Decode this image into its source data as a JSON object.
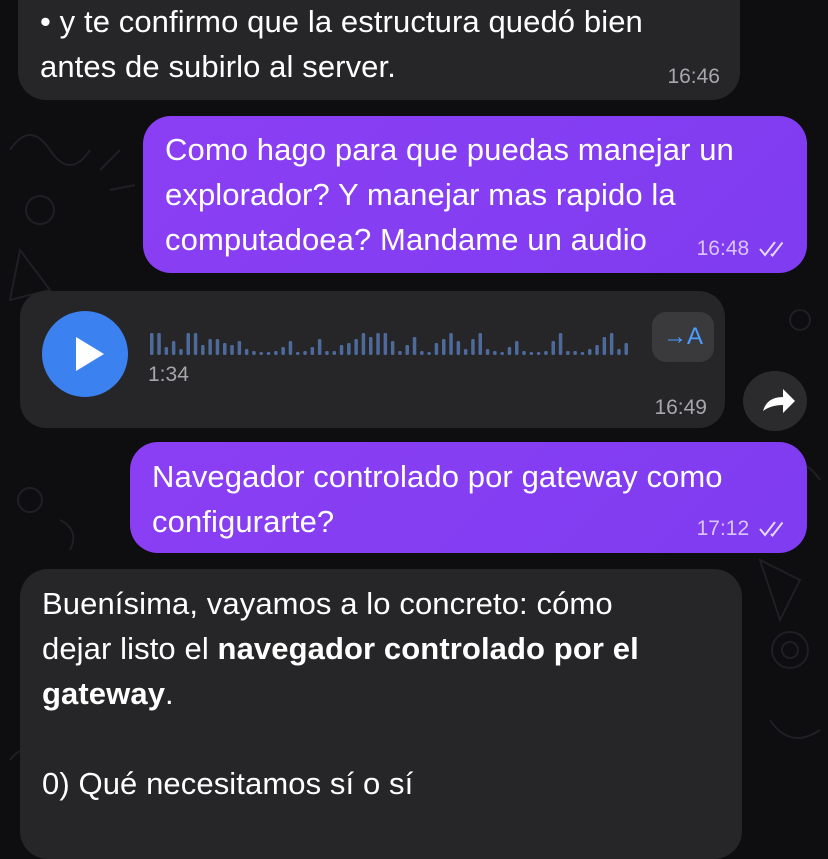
{
  "messages": [
    {
      "id": "m1",
      "direction": "incoming",
      "lines": [
        "• y te confirmo que la estructura quedó bien",
        "antes de subirlo al server."
      ],
      "time": "16:46"
    },
    {
      "id": "m2",
      "direction": "outgoing",
      "lines": [
        "Como hago para que puedas manejar un",
        "explorador? Y manejar mas rapido la",
        "computadoea? Mandame un audio"
      ],
      "time": "16:48",
      "read": true
    },
    {
      "id": "m3",
      "direction": "incoming",
      "type": "voice",
      "duration": "1:34",
      "transcribe_label": "→A",
      "time": "16:49",
      "icons": [
        "play-icon",
        "transcribe-icon",
        "forward-icon"
      ]
    },
    {
      "id": "m4",
      "direction": "outgoing",
      "lines": [
        "Navegador controlado por gateway como",
        "configurarte?"
      ],
      "time": "17:12",
      "read": true
    },
    {
      "id": "m5",
      "direction": "incoming",
      "intro": "Buenísima, vayamos a lo concreto: cómo",
      "intro2": "dejar listo el ",
      "bold": "navegador controlado por el",
      "bold2": "gateway",
      "end": ".",
      "heading": "0) Qué necesitamos sí o sí"
    }
  ],
  "colors": {
    "background": "#0e0e10",
    "incoming_bubble": "#262628",
    "outgoing_bubble": "#8b3ff4",
    "play_button": "#3b82f0",
    "link_blue": "#4c9dff"
  }
}
